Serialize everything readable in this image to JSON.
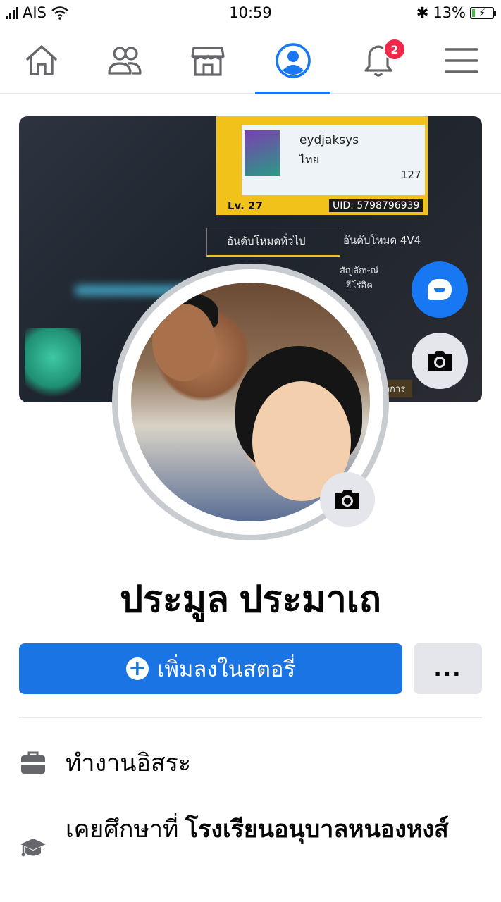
{
  "status_bar": {
    "carrier": "AIS",
    "time": "10:59",
    "battery_percent": "13%",
    "battery_level": 0.13
  },
  "nav": {
    "items": [
      {
        "name": "home",
        "icon": "home-icon"
      },
      {
        "name": "friends",
        "icon": "friends-icon"
      },
      {
        "name": "marketplace",
        "icon": "marketplace-icon"
      },
      {
        "name": "profile",
        "icon": "profile-icon",
        "active": true
      },
      {
        "name": "notifications",
        "icon": "bell-icon",
        "badge": "2"
      },
      {
        "name": "menu",
        "icon": "hamburger-icon"
      }
    ],
    "notification_badge": "2",
    "accent": "#1877f2"
  },
  "cover": {
    "game_player_name": "eydjaksys",
    "game_country": "ไทย",
    "game_likes": "127",
    "game_level": "Lv. 27",
    "game_uid": "UID: 5798796939",
    "game_tab_general": "อันดับโหมดทั่วไป",
    "game_tab_4v4": "อันดับโหมด 4V4",
    "game_side_label_1": "สัญลักษณ์",
    "game_side_label_2": "ฮีโร่อิค",
    "game_button": "จัดการ"
  },
  "profile": {
    "name": "ประมูล ประมาเถ"
  },
  "actions": {
    "add_story_label": "เพิ่มลงในสตอรี่",
    "more_label": "..."
  },
  "intro": {
    "work": "ทำงานอิสระ",
    "education_prefix": "เคยศึกษาที่",
    "education_school": "โรงเรียนอนุบาลหนองหงส์"
  },
  "colors": {
    "primary": "#1b74e4",
    "badge": "#f02849",
    "secondary_button": "#e4e6eb"
  }
}
